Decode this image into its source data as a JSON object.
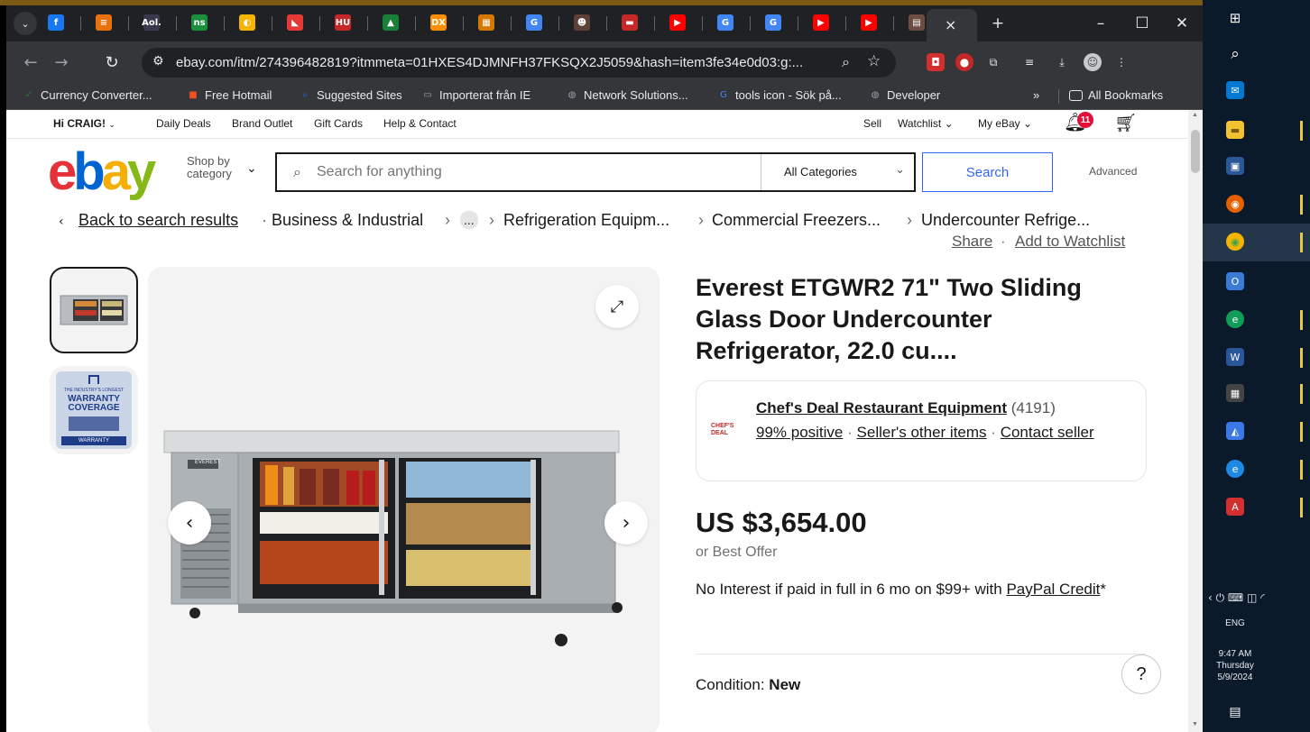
{
  "browser": {
    "url": "ebay.com/itm/274396482819?itmmeta=01HXES4DJMNFH37FKSQX2J5059&hash=item3fe34e0d03:g:...",
    "tabs": [
      {
        "icon": "facebook-icon",
        "glyph": "f",
        "color": "#1877f2"
      },
      {
        "icon": "menu-icon",
        "glyph": "≡",
        "color": "#e8710a"
      },
      {
        "icon": "aol-icon",
        "glyph": "Aol.",
        "color": "#39394d"
      },
      {
        "icon": "ns-icon",
        "glyph": "ns",
        "color": "#1a8f3c"
      },
      {
        "icon": "clock-icon",
        "glyph": "◐",
        "color": "#f4b400"
      },
      {
        "icon": "flag-icon",
        "glyph": "◣",
        "color": "#e53935"
      },
      {
        "icon": "hu-icon",
        "glyph": "HU",
        "color": "#c62828"
      },
      {
        "icon": "drive-icon",
        "glyph": "▲",
        "color": "#188038"
      },
      {
        "icon": "dx-icon",
        "glyph": "DX",
        "color": "#ff8f00"
      },
      {
        "icon": "grid-icon",
        "glyph": "▦",
        "color": "#d47800"
      },
      {
        "icon": "google-icon",
        "glyph": "G",
        "color": "#4285f4"
      },
      {
        "icon": "portrait-icon",
        "glyph": "☻",
        "color": "#5d4037"
      },
      {
        "icon": "stripe-flag-icon",
        "glyph": "▬",
        "color": "#c62828"
      },
      {
        "icon": "youtube-icon",
        "glyph": "▶",
        "color": "#ff0000"
      },
      {
        "icon": "google-icon",
        "glyph": "G",
        "color": "#4285f4"
      },
      {
        "icon": "google-icon",
        "glyph": "G",
        "color": "#4285f4"
      },
      {
        "icon": "youtube-icon",
        "glyph": "▶",
        "color": "#ff0000"
      },
      {
        "icon": "youtube-icon",
        "glyph": "▶",
        "color": "#ff0000"
      },
      {
        "icon": "fridge-icon",
        "glyph": "▤",
        "color": "#6d4c41"
      }
    ],
    "new_tab_glyph": "+",
    "close_glyph": "×",
    "min_glyph": "–",
    "max_glyph": "☐",
    "winclose_glyph": "✕",
    "bookmarks": [
      {
        "label": "Currency Converter...",
        "icon": "currency-icon",
        "glyph": "✓",
        "color": "#2e7d32"
      },
      {
        "label": "Free Hotmail",
        "icon": "windows-icon",
        "glyph": "■",
        "color": "#f25022"
      },
      {
        "label": "Suggested Sites",
        "icon": "search-icon",
        "glyph": "⌕",
        "color": "#1a73e8"
      },
      {
        "label": "Importerat från IE",
        "icon": "folder-icon",
        "glyph": "▭",
        "color": "#9aa0a6"
      },
      {
        "label": "Network Solutions...",
        "icon": "globe-icon",
        "glyph": "◍",
        "color": "#9aa0a6"
      },
      {
        "label": "tools icon - Sök på...",
        "icon": "google-icon",
        "glyph": "G",
        "color": "#4285f4"
      },
      {
        "label": "Developer",
        "icon": "globe-icon",
        "glyph": "◍",
        "color": "#9aa0a6"
      }
    ],
    "more_bookmarks": "»",
    "all_bookmarks": "All Bookmarks"
  },
  "ebay": {
    "header": {
      "greeting": "Hi CRAIG!",
      "links": [
        "Daily Deals",
        "Brand Outlet",
        "Gift Cards",
        "Help & Contact"
      ],
      "sell": "Sell",
      "watchlist": "Watchlist",
      "myebay": "My eBay",
      "notifications": "11"
    },
    "logo": [
      "e",
      "b",
      "a",
      "y"
    ],
    "shop_by": "Shop by category",
    "search_placeholder": "Search for anything",
    "category": "All Categories",
    "search_button": "Search",
    "advanced": "Advanced",
    "breadcrumbs": {
      "back": "Back to search results",
      "items": [
        "Business & Industrial",
        "...",
        "Refrigeration Equipm...",
        "Commercial Freezers...",
        "Undercounter Refrige..."
      ],
      "share": "Share",
      "add_watchlist": "Add to Watchlist"
    },
    "thumb_warranty": {
      "line1": "THE INDUSTRY'S LONGEST",
      "line2": "WARRANTY",
      "line3": "COVERAGE",
      "line4": "WARRANTY"
    },
    "product": {
      "title": "Everest ETGWR2 71\" Two Sliding Glass Door Undercounter Refrigerator, 22.0 cu....",
      "fridge_brand": "EVEREST",
      "seller": {
        "logo_text": "CHEF'S DEAL",
        "name": "Chef's Deal Restaurant Equipment",
        "feedback_count": "(4191)",
        "positive": "99% positive",
        "other_items": "Seller's other items",
        "contact": "Contact seller"
      },
      "price": "US $3,654.00",
      "best_offer": "or Best Offer",
      "credit_text": "No Interest if paid in full in 6 mo on $99+ with",
      "credit_link": "PayPal Credit",
      "credit_mark": "*",
      "condition_label": "Condition:",
      "condition_value": "New"
    },
    "help": "?"
  },
  "taskbar": {
    "language": "ENG",
    "time": "9:47 AM",
    "day": "Thursday",
    "date": "5/9/2024"
  }
}
